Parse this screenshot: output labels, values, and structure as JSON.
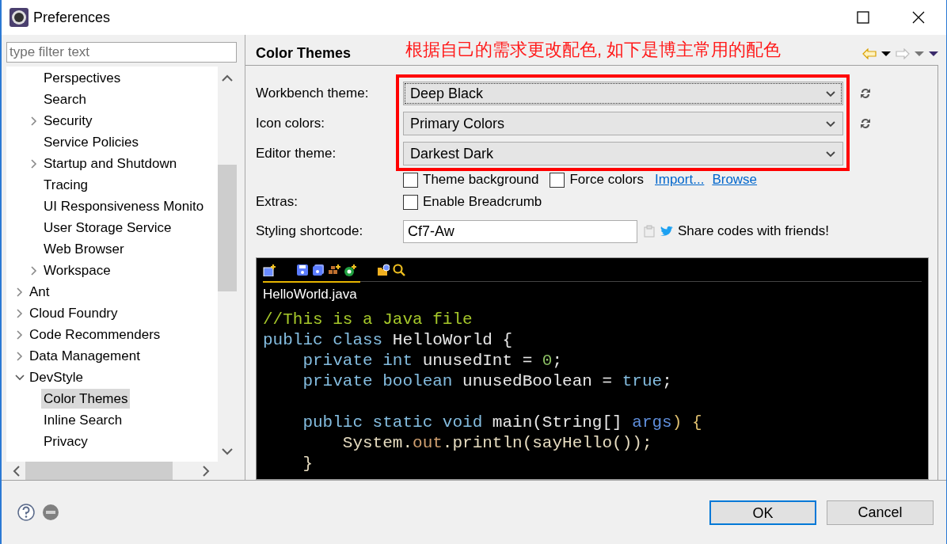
{
  "window": {
    "title": "Preferences"
  },
  "filter": {
    "placeholder": "type filter text"
  },
  "tree": [
    {
      "children": [
        {
          "label": "Perspectives",
          "selected": false
        },
        {
          "label": "Search",
          "selected": false
        },
        {
          "label": "Security",
          "selected": false,
          "expanded": false
        },
        {
          "label": "Service Policies",
          "selected": false
        },
        {
          "label": "Startup and Shutdown",
          "selected": false,
          "expanded": false
        },
        {
          "label": "Tracing",
          "selected": false
        },
        {
          "label": "UI Responsiveness Monito",
          "selected": false
        },
        {
          "label": "User Storage Service",
          "selected": false
        },
        {
          "label": "Web Browser",
          "selected": false
        },
        {
          "label": "Workspace",
          "selected": false,
          "expanded": false
        }
      ]
    },
    {
      "label": "Ant",
      "selected": false,
      "expanded": false
    },
    {
      "label": "Cloud Foundry",
      "selected": false,
      "expanded": false
    },
    {
      "label": "Code Recommenders",
      "selected": false,
      "expanded": false
    },
    {
      "label": "Data Management",
      "selected": false,
      "expanded": false
    },
    {
      "label": "DevStyle",
      "selected": false,
      "expanded": true,
      "children": [
        {
          "label": "Color Themes",
          "selected": true
        },
        {
          "label": "Inline Search",
          "selected": false
        },
        {
          "label": "Privacy",
          "selected": false
        }
      ]
    }
  ],
  "page": {
    "title": "Color Themes",
    "annotation": "根据自己的需求更改配色, 如下是博主常用的配色",
    "settings": [
      {
        "label": "Workbench theme:",
        "value": "Deep Black",
        "focused": true,
        "refresh": true
      },
      {
        "label": "Icon colors:",
        "value": "Primary Colors",
        "focused": false,
        "refresh": true
      },
      {
        "label": "Editor theme:",
        "value": "Darkest Dark",
        "focused": false,
        "refresh": false
      }
    ],
    "options": [
      {
        "kind": "checkbox",
        "label": "Theme background",
        "checked": false
      },
      {
        "kind": "checkbox",
        "label": "Force colors",
        "checked": false
      },
      {
        "kind": "link",
        "label": "Import..."
      },
      {
        "kind": "link",
        "label": "Browse"
      }
    ],
    "extras": {
      "label": "Extras:",
      "options": [
        {
          "label": "Enable Breadcrumb",
          "checked": false
        }
      ]
    },
    "shortcode": {
      "label": "Styling shortcode:",
      "value": "Cf7-Aw",
      "share": "Share codes with friends!"
    },
    "preview": {
      "tab": "HelloWorld.java",
      "lines": [
        {
          "kind": "code",
          "tokens": [
            {
              "text": "//This is a Java file",
              "kind": "comment"
            }
          ]
        },
        {
          "kind": "code",
          "tokens": [
            {
              "text": "public class",
              "kind": "keyword"
            },
            {
              "text": " HelloWorld {",
              "kind": "plain"
            }
          ]
        },
        {
          "kind": "code",
          "tokens": [
            {
              "text": "    private int",
              "kind": "keyword"
            },
            {
              "text": " unusedInt = ",
              "kind": "plain"
            },
            {
              "text": "0",
              "kind": "number"
            },
            {
              "text": ";",
              "kind": "plain"
            }
          ]
        },
        {
          "kind": "code",
          "tokens": [
            {
              "text": "    private boolean",
              "kind": "keyword"
            },
            {
              "text": " unusedBoolean = ",
              "kind": "plain"
            },
            {
              "text": "true",
              "kind": "keyword"
            },
            {
              "text": ";",
              "kind": "plain"
            }
          ]
        },
        {
          "kind": "blank"
        },
        {
          "kind": "code",
          "tokens": [
            {
              "text": "    public static void",
              "kind": "keyword"
            },
            {
              "text": " main(String[] ",
              "kind": "plain"
            },
            {
              "text": "args",
              "kind": "param"
            },
            {
              "text": ") {",
              "kind": "brace"
            }
          ]
        },
        {
          "kind": "code",
          "tokens": [
            {
              "text": "        System.",
              "kind": "method"
            },
            {
              "text": "out",
              "kind": "field"
            },
            {
              "text": ".println(sayHello());",
              "kind": "method"
            }
          ]
        },
        {
          "kind": "code",
          "tokens": [
            {
              "text": "    }",
              "kind": "method"
            }
          ]
        }
      ]
    }
  },
  "buttons": [
    {
      "label": "OK",
      "default": true
    },
    {
      "label": "Cancel",
      "default": false
    }
  ]
}
